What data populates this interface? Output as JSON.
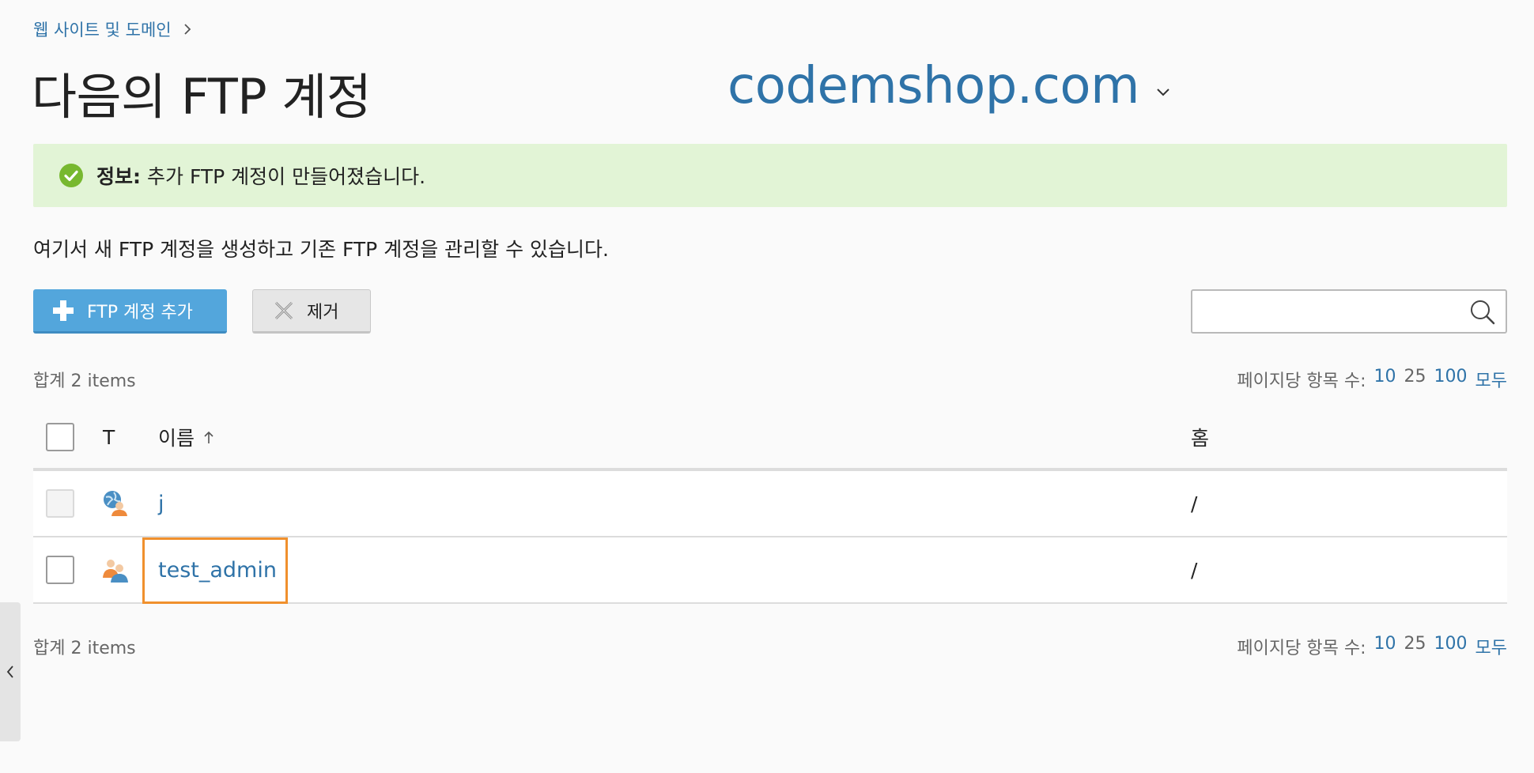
{
  "breadcrumb": {
    "label": "웹 사이트 및 도메인"
  },
  "header": {
    "title": "다음의 FTP 계정",
    "domain": "codemshop.com"
  },
  "banner": {
    "label": "정보:",
    "message": "추가 FTP 계정이 만들어졌습니다."
  },
  "description": "여기서 새 FTP 계정을 생성하고 기존 FTP 계정을 관리할 수 있습니다.",
  "toolbar": {
    "add_label": "FTP 계정 추가",
    "remove_label": "제거"
  },
  "search": {
    "placeholder": "",
    "value": ""
  },
  "summary": "합계 2 items",
  "pager": {
    "label": "페이지당 항목 수:",
    "options": [
      "10",
      "25",
      "100",
      "모두"
    ],
    "current": "25"
  },
  "table": {
    "columns": {
      "type": "T",
      "name": "이름",
      "home": "홈"
    },
    "sort": {
      "column": "name",
      "direction": "ascending"
    },
    "rows": [
      {
        "name": "j",
        "home": "/",
        "type_icon": "globe-user-icon",
        "selectable": false
      },
      {
        "name": "test_admin",
        "home": "/",
        "type_icon": "users-icon",
        "selectable": true,
        "highlighted": true
      }
    ]
  },
  "colors": {
    "link": "#2f73a8",
    "primary_button": "#53a6dc",
    "banner_bg": "#e2f4d6",
    "success": "#77b82f",
    "highlight": "#f0902d"
  }
}
